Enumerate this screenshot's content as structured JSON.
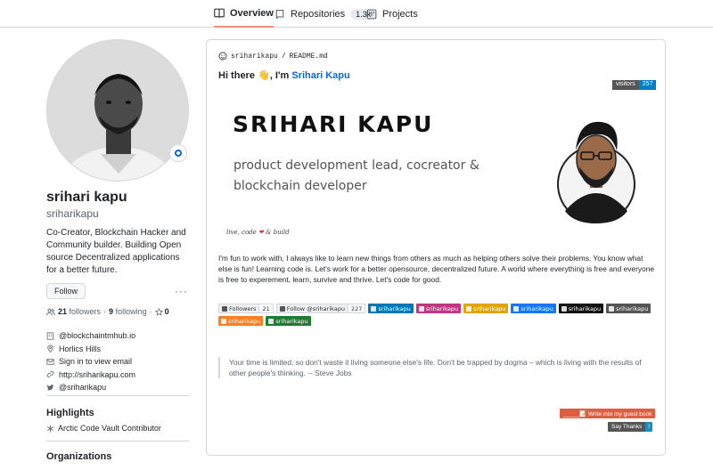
{
  "nav": {
    "tabs": [
      {
        "label": "Overview",
        "icon": "book-icon"
      },
      {
        "label": "Repositories",
        "icon": "repo-icon",
        "counter": "1.3k"
      },
      {
        "label": "Projects",
        "icon": "project-icon"
      }
    ]
  },
  "profile": {
    "fullname": "srihari kapu",
    "username": "sriharikapu",
    "bio": "Co-Creator, Blockchain Hacker and Community builder. Building Open source Decentralized applications for a better future.",
    "follow_label": "Follow",
    "more_label": "···",
    "followers_count": "21",
    "followers_label": "followers",
    "following_count": "9",
    "following_label": "following",
    "stars_count": "0",
    "dot": "·",
    "details": {
      "org": "@blockchaintmhub.io",
      "location": "Horlics Hills",
      "email": "Sign in to view email",
      "website": "http://sriharikapu.com",
      "twitter": "@sriharikapu"
    },
    "highlights_title": "Highlights",
    "highlight_item": "Arctic Code Vault Contributor",
    "organizations_title": "Organizations"
  },
  "readme": {
    "path_user": "sriharikapu",
    "path_sep": "/",
    "path_file": "README.md",
    "greeting_prefix": "Hi there 👋, I'm ",
    "greeting_name": "Srihari Kapu",
    "visitors_label": "visitors",
    "visitors_count": "257",
    "banner_name": "SRIHARI KAPU",
    "banner_sub": "product development lead, cocreator & blockchain developer",
    "signature_a": "live, code",
    "signature_heart": "❤",
    "signature_b": "& build",
    "intro": "I'm fun to work with, I always like to learn new things from others as much as helping others solve their problems. You know what else is fun! Learning code is. Let's work for a better opensource, decentralized future. A world where everything is free and everyone is free to experement, learn, survive and thrive. Let's code for good.",
    "badges": [
      {
        "a": "Followers",
        "b": "21",
        "light": true,
        "icon": "github-icon"
      },
      {
        "a": "Follow @sriharikapu",
        "b": "227",
        "light": true,
        "icon": "twitter-icon"
      },
      {
        "a": "sriharikapu",
        "color": "#0077b5",
        "icon": "linkedin-icon"
      },
      {
        "a": "sriharikapu",
        "color": "#c13584",
        "icon": "instagram-icon"
      },
      {
        "a": "sriharikapu",
        "color": "#e2a500",
        "icon": "angellist-icon"
      },
      {
        "a": "sriharikapu",
        "color": "#1877f2",
        "icon": "facebook-icon"
      },
      {
        "a": "sriharikapu",
        "color": "#111111",
        "icon": "medium-icon"
      },
      {
        "a": "sriharikapu",
        "color": "#555555",
        "icon": "telegram-icon"
      },
      {
        "a": "sriharikapu",
        "color": "#f58025",
        "icon": "stackoverflow-icon"
      },
      {
        "a": "sriharikapu",
        "color": "#1e7c32",
        "icon": "check-icon"
      }
    ],
    "quote": "Your time is limited, so don't waste it living someone else's life. Don't be trapped by dogma – which is living with the results of other people's thinking. -- Steve Jobs",
    "guestbook_label": "_____📝 Write into my guest book",
    "thanks_label": "Say Thanks",
    "thanks_count": "!"
  }
}
